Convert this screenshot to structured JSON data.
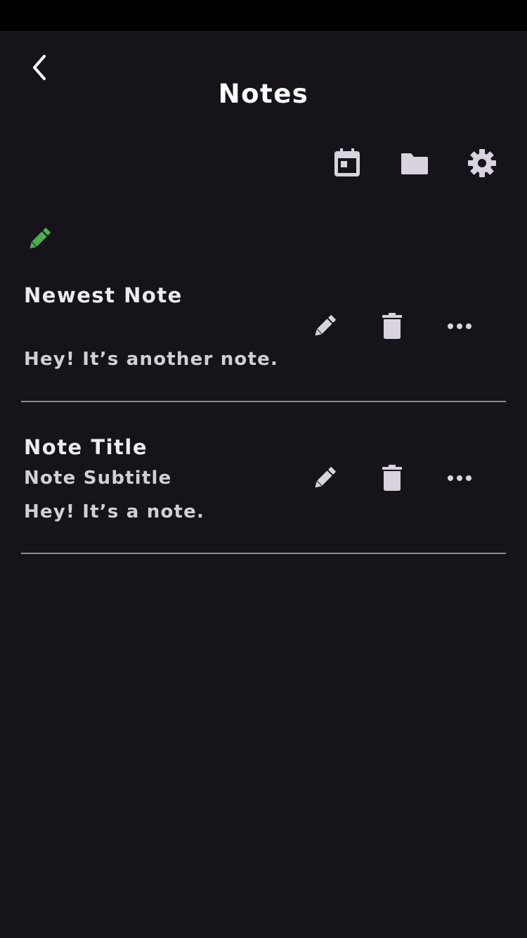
{
  "header": {
    "title": "Notes"
  },
  "toolbar": {
    "icons": [
      "calendar-icon",
      "folder-icon",
      "settings-gear-icon"
    ]
  },
  "compose": {
    "icon": "pencil-icon",
    "color": "#4caf50"
  },
  "notes": [
    {
      "title": "Newest Note",
      "subtitle": "",
      "body": "Hey! It’s another note."
    },
    {
      "title": "Note Title",
      "subtitle": "Note Subtitle",
      "body": "Hey! It’s a note."
    }
  ],
  "row_actions": [
    "edit-icon",
    "trash-icon",
    "more-icon"
  ],
  "colors": {
    "background": "#16141a",
    "status_bar": "#000000",
    "icon": "#d9d3de",
    "accent_green": "#4caf50",
    "divider": "#8e8a93"
  }
}
